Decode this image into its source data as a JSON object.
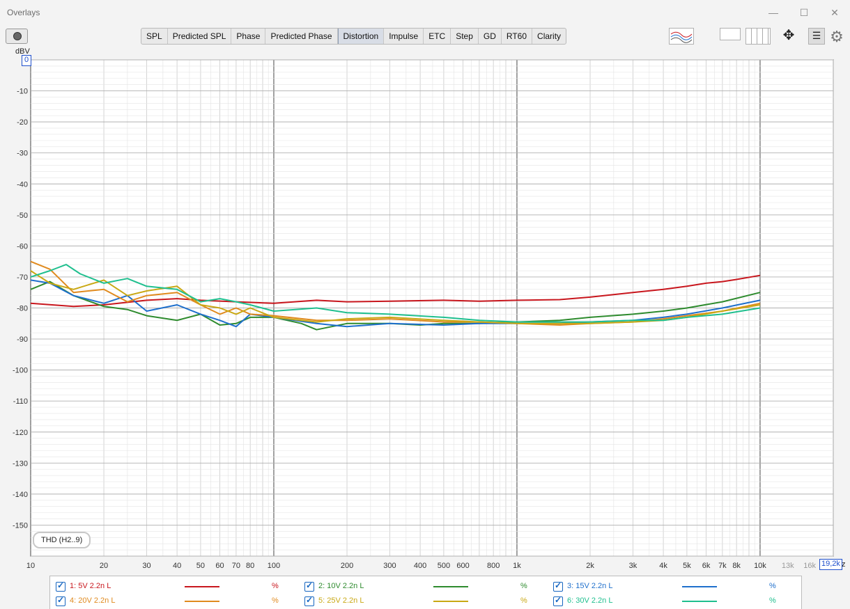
{
  "window": {
    "title": "Overlays",
    "minimize": "—",
    "maximize": "☐",
    "close": "✕"
  },
  "toolbar": {
    "camera_icon": "camera-icon",
    "tabs": [
      "SPL",
      "Predicted SPL",
      "Phase",
      "Predicted Phase",
      "Distortion",
      "Impulse",
      "ETC",
      "Step",
      "GD",
      "RT60",
      "Clarity"
    ],
    "active_tab": "Distortion",
    "gear_icon": "gear-icon"
  },
  "plot": {
    "y_unit": "dBV",
    "x_unit_fragment": "z",
    "x_readout": "19,2k",
    "y_readout": "0",
    "distortion_label": "THD (H2..9)"
  },
  "chart_data": {
    "type": "line",
    "title": "",
    "xlabel": "",
    "ylabel": "dBV",
    "x_scale": "log",
    "xlim": [
      10,
      20000
    ],
    "ylim": [
      -160,
      0
    ],
    "grid": true,
    "x_ticks": [
      "10",
      "20",
      "30",
      "40",
      "50",
      "60",
      "70",
      "80",
      "100",
      "200",
      "300",
      "400",
      "500",
      "600",
      "800",
      "1k",
      "2k",
      "3k",
      "4k",
      "5k",
      "6k",
      "7k",
      "8k",
      "10k",
      "13k",
      "16k"
    ],
    "y_ticks": [
      "0",
      "-10",
      "-20",
      "-30",
      "-40",
      "-50",
      "-60",
      "-70",
      "-80",
      "-90",
      "-100",
      "-110",
      "-120",
      "-130",
      "-140",
      "-150"
    ],
    "series": [
      {
        "name": "1: 5V 2.2n L",
        "color": "#c8161d",
        "unit": "%",
        "points": [
          [
            10,
            -78.5
          ],
          [
            15,
            -79.5
          ],
          [
            20,
            -79
          ],
          [
            30,
            -77.5
          ],
          [
            40,
            -77
          ],
          [
            50,
            -77.5
          ],
          [
            70,
            -78
          ],
          [
            100,
            -78.5
          ],
          [
            150,
            -77.5
          ],
          [
            200,
            -78
          ],
          [
            300,
            -77.8
          ],
          [
            500,
            -77.5
          ],
          [
            700,
            -77.8
          ],
          [
            1000,
            -77.5
          ],
          [
            1500,
            -77.3
          ],
          [
            2000,
            -76.5
          ],
          [
            3000,
            -75
          ],
          [
            4000,
            -74
          ],
          [
            5000,
            -73
          ],
          [
            6000,
            -72
          ],
          [
            7000,
            -71.5
          ],
          [
            8000,
            -70.8
          ],
          [
            10000,
            -69.5
          ]
        ]
      },
      {
        "name": "2: 10V 2.2n L",
        "color": "#2e8b2e",
        "unit": "%",
        "points": [
          [
            10,
            -74
          ],
          [
            12,
            -71.5
          ],
          [
            15,
            -76
          ],
          [
            20,
            -79.5
          ],
          [
            25,
            -80.5
          ],
          [
            30,
            -82.5
          ],
          [
            40,
            -84
          ],
          [
            50,
            -82
          ],
          [
            60,
            -85.5
          ],
          [
            70,
            -85
          ],
          [
            80,
            -83
          ],
          [
            100,
            -83
          ],
          [
            130,
            -85
          ],
          [
            150,
            -87
          ],
          [
            200,
            -85
          ],
          [
            300,
            -85
          ],
          [
            400,
            -85.5
          ],
          [
            500,
            -85
          ],
          [
            700,
            -85
          ],
          [
            1000,
            -84.5
          ],
          [
            1500,
            -84
          ],
          [
            2000,
            -83
          ],
          [
            3000,
            -82
          ],
          [
            4000,
            -81
          ],
          [
            5000,
            -80
          ],
          [
            7000,
            -78
          ],
          [
            10000,
            -75
          ]
        ]
      },
      {
        "name": "3: 15V 2.2n L",
        "color": "#1e6fcc",
        "unit": "%",
        "points": [
          [
            10,
            -71
          ],
          [
            12,
            -72
          ],
          [
            15,
            -76
          ],
          [
            20,
            -78.5
          ],
          [
            25,
            -76
          ],
          [
            30,
            -81
          ],
          [
            40,
            -79
          ],
          [
            50,
            -82
          ],
          [
            60,
            -84
          ],
          [
            70,
            -86
          ],
          [
            80,
            -82
          ],
          [
            100,
            -83
          ],
          [
            150,
            -85
          ],
          [
            200,
            -86
          ],
          [
            300,
            -85
          ],
          [
            500,
            -85.5
          ],
          [
            700,
            -85
          ],
          [
            1000,
            -85
          ],
          [
            1500,
            -85
          ],
          [
            2000,
            -84.5
          ],
          [
            3000,
            -84
          ],
          [
            4000,
            -83
          ],
          [
            5000,
            -82
          ],
          [
            7000,
            -80
          ],
          [
            10000,
            -77.5
          ]
        ]
      },
      {
        "name": "4: 20V 2.2n L",
        "color": "#e08a1e",
        "unit": "%",
        "points": [
          [
            10,
            -65
          ],
          [
            12,
            -67.5
          ],
          [
            15,
            -75
          ],
          [
            20,
            -74
          ],
          [
            25,
            -78
          ],
          [
            30,
            -76
          ],
          [
            40,
            -75
          ],
          [
            50,
            -79
          ],
          [
            60,
            -82
          ],
          [
            70,
            -80
          ],
          [
            80,
            -82
          ],
          [
            100,
            -82.5
          ],
          [
            150,
            -84
          ],
          [
            200,
            -84
          ],
          [
            300,
            -83.5
          ],
          [
            500,
            -84.5
          ],
          [
            700,
            -84.5
          ],
          [
            1000,
            -85
          ],
          [
            1500,
            -85.5
          ],
          [
            2000,
            -85
          ],
          [
            3000,
            -84.5
          ],
          [
            4000,
            -83.5
          ],
          [
            5000,
            -82.5
          ],
          [
            7000,
            -81
          ],
          [
            10000,
            -78.5
          ]
        ]
      },
      {
        "name": "5: 25V 2.2n L",
        "color": "#c9a814",
        "unit": "%",
        "points": [
          [
            10,
            -68
          ],
          [
            12,
            -72
          ],
          [
            15,
            -74
          ],
          [
            20,
            -71
          ],
          [
            25,
            -76
          ],
          [
            30,
            -74.5
          ],
          [
            40,
            -73
          ],
          [
            50,
            -79
          ],
          [
            60,
            -80
          ],
          [
            70,
            -82
          ],
          [
            80,
            -80
          ],
          [
            100,
            -83
          ],
          [
            150,
            -84.5
          ],
          [
            200,
            -83.5
          ],
          [
            300,
            -83
          ],
          [
            500,
            -84
          ],
          [
            700,
            -84.5
          ],
          [
            1000,
            -85
          ],
          [
            1500,
            -85
          ],
          [
            2000,
            -85
          ],
          [
            3000,
            -84.5
          ],
          [
            4000,
            -84
          ],
          [
            5000,
            -83
          ],
          [
            7000,
            -81
          ],
          [
            10000,
            -79
          ]
        ]
      },
      {
        "name": "6: 30V 2.2n L",
        "color": "#1fbf8e",
        "unit": "%",
        "points": [
          [
            10,
            -70
          ],
          [
            12,
            -68
          ],
          [
            14,
            -66
          ],
          [
            16,
            -69
          ],
          [
            20,
            -72
          ],
          [
            25,
            -70.5
          ],
          [
            30,
            -73
          ],
          [
            40,
            -74
          ],
          [
            50,
            -78
          ],
          [
            60,
            -77
          ],
          [
            70,
            -78
          ],
          [
            80,
            -79
          ],
          [
            100,
            -81
          ],
          [
            150,
            -80
          ],
          [
            200,
            -81.5
          ],
          [
            300,
            -82
          ],
          [
            500,
            -83
          ],
          [
            700,
            -84
          ],
          [
            1000,
            -84.5
          ],
          [
            1500,
            -84.5
          ],
          [
            2000,
            -84.5
          ],
          [
            3000,
            -84
          ],
          [
            4000,
            -84
          ],
          [
            5000,
            -83
          ],
          [
            7000,
            -82
          ],
          [
            10000,
            -80
          ]
        ]
      }
    ]
  }
}
